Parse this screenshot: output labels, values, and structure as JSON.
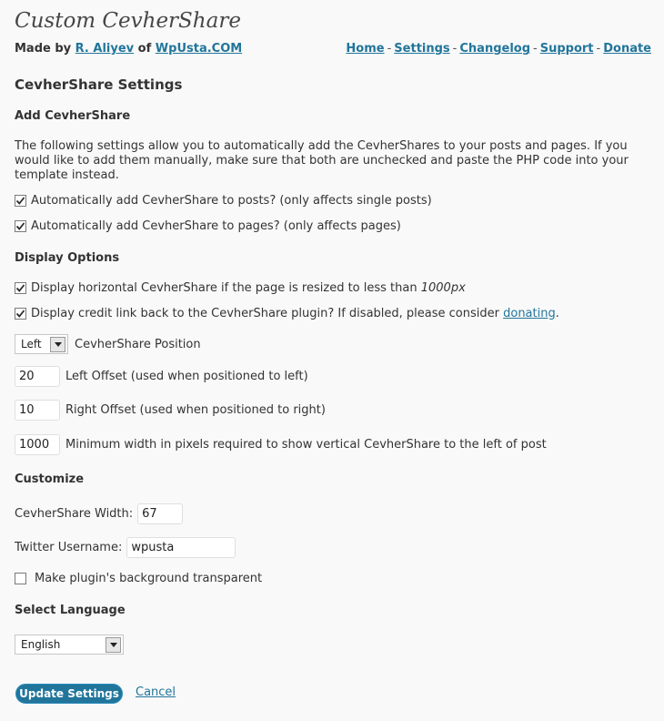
{
  "header": {
    "title": "Custom CevherShare",
    "made_by_label": "Made by",
    "author": "R. Aliyev",
    "of_label": "of",
    "site": "WpUsta.COM",
    "nav": [
      "Home",
      "Settings",
      "Changelog",
      "Support",
      "Donate"
    ],
    "nav_separator": "-"
  },
  "settings_title": "CevherShare Settings",
  "add_section": {
    "heading": "Add CevherShare",
    "description": "The following settings allow you to automatically add the CevherShares to your posts and pages. If you would like to add them manually, make sure that both are unchecked and paste the PHP code into your template instead.",
    "options": [
      {
        "label": "Automatically add CevherShare to posts? (only affects single posts)",
        "checked": true
      },
      {
        "label": "Automatically add CevherShare to pages? (only affects pages)",
        "checked": true
      }
    ]
  },
  "display_section": {
    "heading": "Display Options",
    "horizontal_label": "Display horizontal CevherShare if the page is resized to less than",
    "horizontal_value": "1000px",
    "horizontal_checked": true,
    "credit_label": "Display credit link back to the CevherShare plugin? If disabled, please consider",
    "credit_link": "donating",
    "credit_suffix": ".",
    "credit_checked": true,
    "position_value": "Left",
    "position_label": "CevherShare Position",
    "left_offset_value": "20",
    "left_offset_label": "Left Offset (used when positioned to left)",
    "right_offset_value": "10",
    "right_offset_label": "Right Offset (used when positioned to right)",
    "min_width_value": "1000",
    "min_width_label": "Minimum width in pixels required to show vertical CevherShare to the left of post"
  },
  "customize_section": {
    "heading": "Customize",
    "width_label": "CevherShare Width:",
    "width_value": "67",
    "twitter_label": "Twitter Username:",
    "twitter_value": "wpusta",
    "transparent_label": "Make plugin's background transparent",
    "transparent_checked": false
  },
  "language_section": {
    "heading": "Select Language",
    "value": "English"
  },
  "actions": {
    "update_label": "Update Settings",
    "cancel_label": "Cancel"
  },
  "colors": {
    "link": "#21759b",
    "button": "#21759b",
    "background": "#f9f9f9"
  }
}
